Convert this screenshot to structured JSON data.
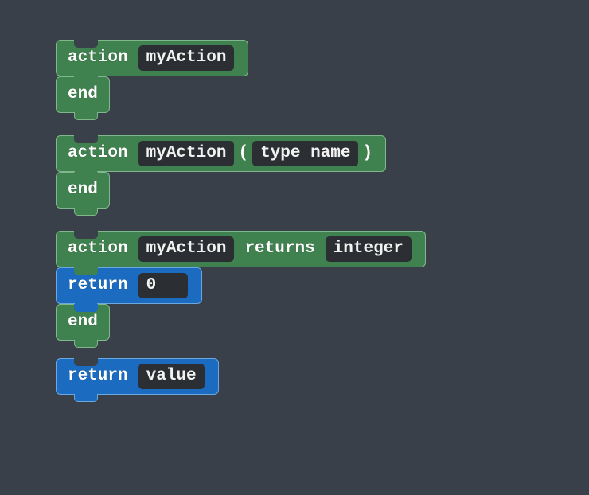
{
  "blocks": {
    "stack1": {
      "action_kw": "action",
      "name": "myAction",
      "end_kw": "end"
    },
    "stack2": {
      "action_kw": "action",
      "name": "myAction",
      "lparen": "(",
      "param": "type name",
      "rparen": ")",
      "end_kw": "end"
    },
    "stack3": {
      "action_kw": "action",
      "name": "myAction",
      "returns_kw": "returns",
      "return_type": "integer",
      "return_kw": "return",
      "return_value": "0",
      "end_kw": "end"
    },
    "stack4": {
      "return_kw": "return",
      "value": "value"
    }
  }
}
